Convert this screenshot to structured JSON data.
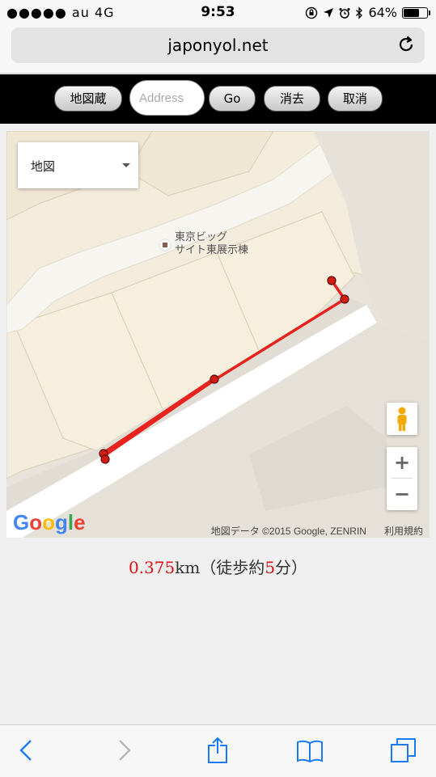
{
  "status_bar": {
    "carrier": "●●●●● au  4G",
    "time": "9:53",
    "battery": "64%",
    "battery_level": 0.64,
    "icons": [
      "rotation-lock-icon",
      "location-icon",
      "alarm-icon",
      "bluetooth-icon",
      "battery-icon"
    ]
  },
  "browser": {
    "url": "japonyol.net",
    "reload_icon": "reload-icon"
  },
  "toolbar": {
    "map_button": "地図蔵",
    "address_placeholder": "Address",
    "go_button": "Go",
    "clear_button": "消去",
    "cancel_button": "取消"
  },
  "map": {
    "map_type": "地図",
    "poi_line1": "東京ビッグ",
    "poi_line2": "サイト東展示棟",
    "zoom_in": "+",
    "zoom_out": "−",
    "google_logo": "Google",
    "attribution": "地図データ ©2015 Google, ZENRIN",
    "terms": "利用規約",
    "route_color": "#e8231e"
  },
  "result": {
    "distance": "0.375",
    "unit": "km（徒歩約",
    "minutes": "5",
    "suffix": "分）"
  },
  "bottom_nav": [
    "back-icon",
    "forward-icon",
    "share-icon",
    "bookmarks-icon",
    "tabs-icon"
  ]
}
